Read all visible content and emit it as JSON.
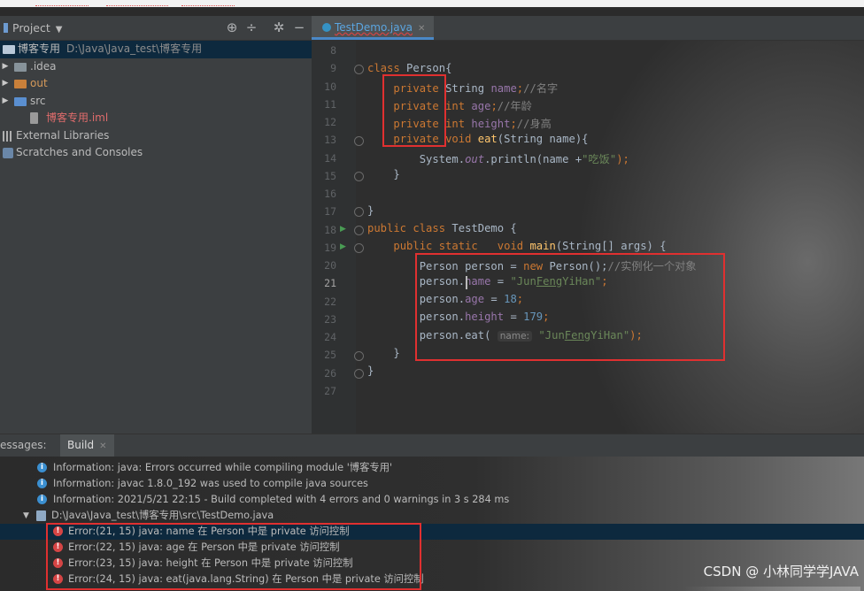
{
  "project": {
    "title": "Project",
    "tree": [
      {
        "name": "博客专用",
        "path": "D:\\Java\\Java_test\\博客专用"
      },
      {
        "name": ".idea"
      },
      {
        "name": "out"
      },
      {
        "name": "src"
      },
      {
        "name": "博客专用.iml"
      },
      {
        "name": "External Libraries"
      },
      {
        "name": "Scratches and Consoles"
      }
    ]
  },
  "editor": {
    "tab": "TestDemo.java",
    "line_numbers": [
      "8",
      "9",
      "10",
      "11",
      "12",
      "13",
      "14",
      "15",
      "16",
      "17",
      "18",
      "19",
      "20",
      "21",
      "22",
      "23",
      "24",
      "25",
      "26",
      "27"
    ],
    "current_line": "21",
    "code": {
      "l9": [
        "class ",
        "Person",
        "{"
      ],
      "l10": [
        "private ",
        "String ",
        "name",
        ";",
        "//名字"
      ],
      "l11": [
        "private ",
        "int ",
        "age",
        ";",
        "//年龄"
      ],
      "l12": [
        "private ",
        "int ",
        "height",
        ";",
        "//身高"
      ],
      "l13": [
        "private ",
        "void ",
        "eat",
        "(String name){"
      ],
      "l14": [
        "System.",
        "out",
        ".println(name +",
        "\"吃饭\"",
        ");"
      ],
      "l15": [
        "}"
      ],
      "l17": [
        "}"
      ],
      "l18": [
        "public class ",
        "TestDemo {"
      ],
      "l19": [
        "public static ",
        "  void ",
        "main",
        "(String[] args) {"
      ],
      "l20": [
        "Person person = ",
        "new ",
        "Person();",
        "//实例化一个对象"
      ],
      "l21": [
        "person.",
        "name",
        " = ",
        "\"Jun",
        "Feng",
        "YiHan\"",
        ";"
      ],
      "l22": [
        "person.",
        "age",
        " = ",
        "18",
        ";"
      ],
      "l23": [
        "person.",
        "height",
        " = ",
        "179",
        ";"
      ],
      "l24": [
        "person.eat( ",
        "name:",
        " \"Jun",
        "Feng",
        "YiHan\"",
        ");"
      ],
      "l25": [
        "}"
      ],
      "l26": [
        "}"
      ]
    }
  },
  "messages": {
    "label": "essages:",
    "tab": "Build",
    "rows": [
      {
        "type": "info",
        "text": "Information: java: Errors occurred while compiling module '博客专用'"
      },
      {
        "type": "info",
        "text": "Information: javac 1.8.0_192 was used to compile java sources"
      },
      {
        "type": "info",
        "text": "Information: 2021/5/21 22:15 - Build completed with 4 errors and 0 warnings in 3 s 284 ms"
      },
      {
        "type": "file",
        "text": "D:\\Java\\Java_test\\博客专用\\src\\TestDemo.java"
      },
      {
        "type": "error",
        "text": "Error:(21, 15)  java: name 在 Person 中是 private 访问控制"
      },
      {
        "type": "error",
        "text": "Error:(22, 15)  java: age 在 Person 中是 private 访问控制"
      },
      {
        "type": "error",
        "text": "Error:(23, 15)  java: height 在 Person 中是 private 访问控制"
      },
      {
        "type": "error",
        "text": "Error:(24, 15)  java: eat(java.lang.String) 在 Person 中是 private 访问控制"
      }
    ]
  },
  "watermark": "CSDN @ 小林同学学JAVA",
  "colors": {
    "keyword": "#cc7832",
    "field": "#9876aa",
    "string": "#6a8759",
    "number": "#6897bb",
    "comment": "#808080",
    "function": "#ffc66d",
    "annotation_box": "#e03030",
    "error_icon": "#d64545",
    "info_icon": "#3b8fd0"
  },
  "icons": [
    "project-icon",
    "locate-icon",
    "collapse-icon",
    "gear-icon",
    "minimize-icon",
    "class-file-icon",
    "run-arrow-icon",
    "info-icon",
    "error-icon",
    "folder-icon"
  ]
}
